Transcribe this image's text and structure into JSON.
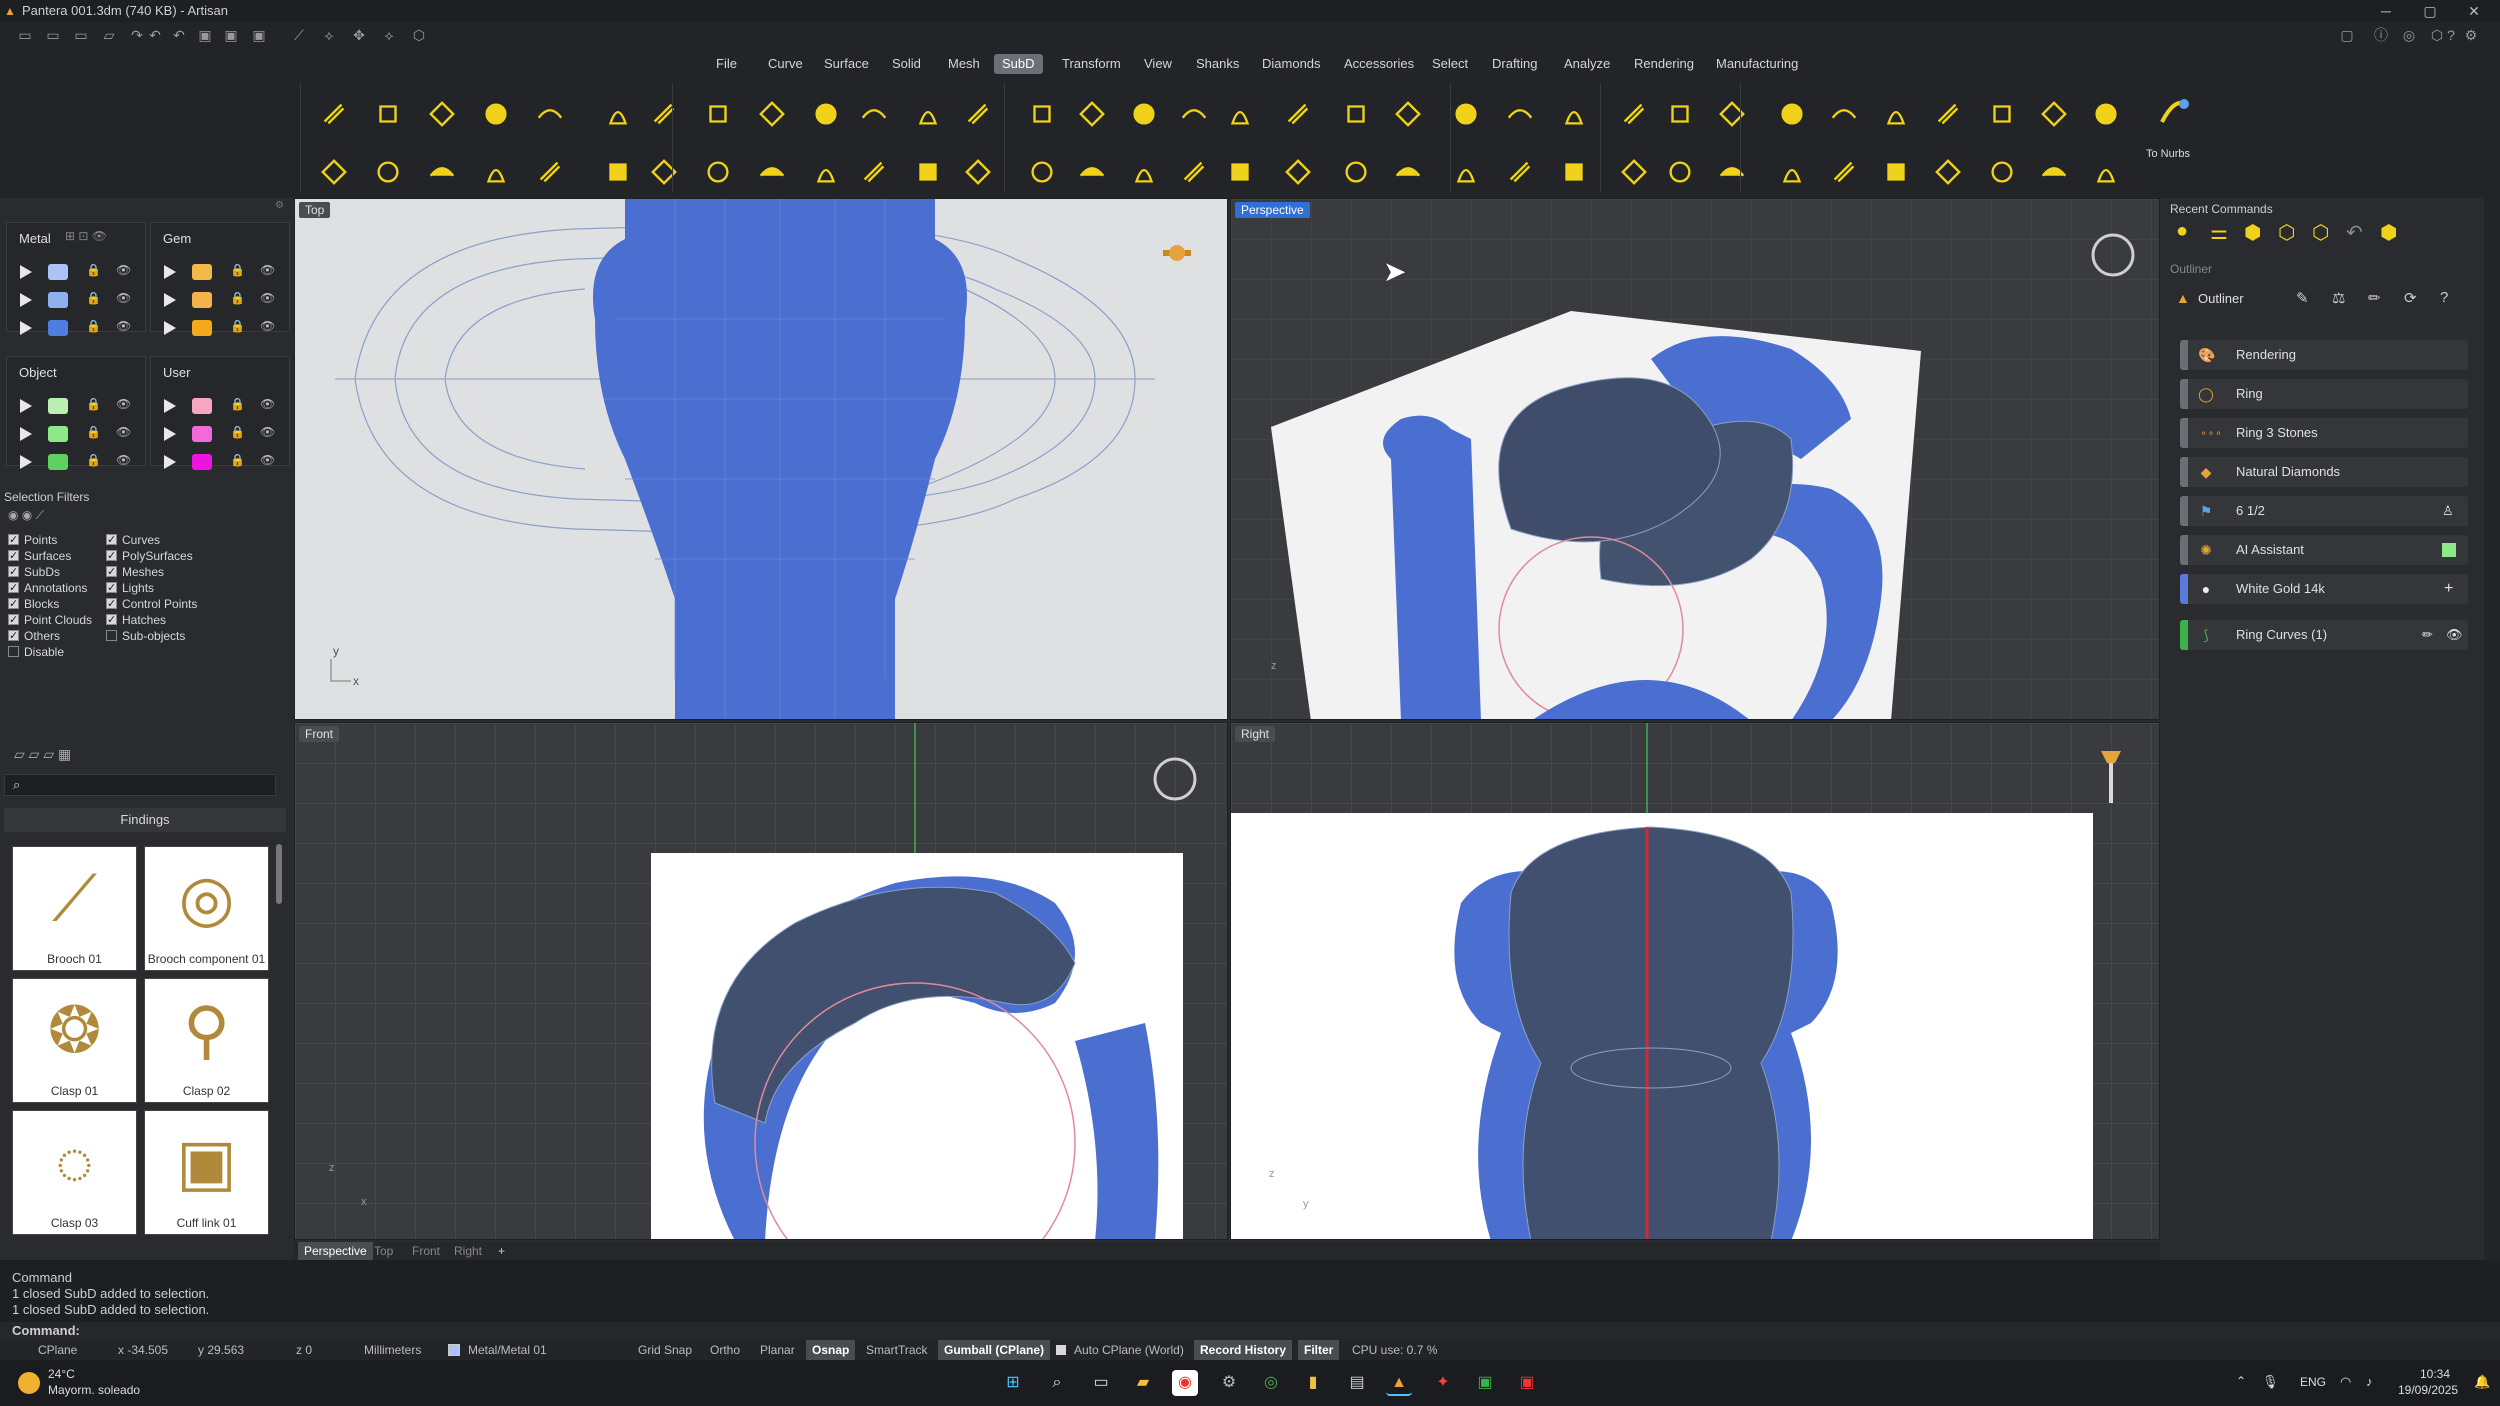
{
  "window": {
    "title": "Pantera 001.3dm (740 KB) - Artisan",
    "controls": [
      "─",
      "▢",
      "✕"
    ]
  },
  "menu": {
    "items": [
      "File",
      "Curve",
      "Surface",
      "Solid",
      "Mesh",
      "SubD",
      "Transform",
      "View",
      "Shanks",
      "Diamonds",
      "Accessories",
      "Select",
      "Drafting",
      "Analyze",
      "Rendering",
      "Manufacturing"
    ],
    "active": "SubD"
  },
  "ribbon": {
    "to_nurbs_label": "To Nurbs"
  },
  "layers": {
    "groups": [
      {
        "name": "Metal",
        "colors": [
          "#a9c4f5",
          "#8fb0ee",
          "#4f7de0"
        ]
      },
      {
        "name": "Gem",
        "colors": [
          "#f5b94a",
          "#f3b24a",
          "#f2a91a"
        ]
      },
      {
        "name": "Object",
        "colors": [
          "#b9f2b0",
          "#8ee88a",
          "#5fcf5f"
        ]
      },
      {
        "name": "User",
        "colors": [
          "#f5a7c2",
          "#f06ad8",
          "#ee14e0"
        ]
      }
    ]
  },
  "selection_filters": {
    "title": "Selection Filters",
    "left": [
      {
        "label": "Points",
        "on": true
      },
      {
        "label": "Surfaces",
        "on": true
      },
      {
        "label": "SubDs",
        "on": true
      },
      {
        "label": "Annotations",
        "on": true
      },
      {
        "label": "Blocks",
        "on": true
      },
      {
        "label": "Point Clouds",
        "on": true
      },
      {
        "label": "Others",
        "on": true
      },
      {
        "label": "Disable",
        "on": false
      }
    ],
    "right": [
      {
        "label": "Curves",
        "on": true
      },
      {
        "label": "PolySurfaces",
        "on": true
      },
      {
        "label": "Meshes",
        "on": true
      },
      {
        "label": "Lights",
        "on": true
      },
      {
        "label": "Control Points",
        "on": true
      },
      {
        "label": "Hatches",
        "on": true
      },
      {
        "label": "Sub-objects",
        "on": false
      }
    ]
  },
  "library": {
    "category": "Findings",
    "items": [
      "Brooch 01",
      "Brooch component 01",
      "Clasp 01",
      "Clasp 02",
      "Clasp 03",
      "Cuff link 01"
    ]
  },
  "viewports": {
    "top": "Top",
    "perspective": "Perspective",
    "front": "Front",
    "right": "Right",
    "tabs": [
      "Perspective",
      "Top",
      "Front",
      "Right"
    ],
    "add_tab": "+"
  },
  "recent_commands": {
    "title": "Recent Commands"
  },
  "outliner": {
    "panel_title": "Outliner",
    "header": "Outliner",
    "rows": [
      {
        "label": "Rendering",
        "icon": "palette-icon"
      },
      {
        "label": "Ring",
        "icon": "ring-icon"
      },
      {
        "label": "Ring 3 Stones",
        "icon": "three-stones-icon"
      },
      {
        "label": "Natural Diamonds",
        "icon": "diamond-icon"
      },
      {
        "label": "6 1/2",
        "icon": "flag-icon"
      },
      {
        "label": "AI Assistant",
        "icon": "ai-icon"
      },
      {
        "label": "White Gold 14k",
        "icon": "material-icon"
      }
    ],
    "curves_row": "Ring Curves (1)"
  },
  "command": {
    "header": "Command",
    "history": [
      "1 closed SubD added to selection.",
      "1 closed SubD added to selection."
    ],
    "prompt": "Command:"
  },
  "status": {
    "cplane": "CPlane",
    "x": "x -34.505",
    "y": "y 29.563",
    "z": "z 0",
    "units": "Millimeters",
    "layer": "Metal/Metal 01",
    "grid_snap": "Grid Snap",
    "ortho": "Ortho",
    "planar": "Planar",
    "osnap": "Osnap",
    "smarttrack": "SmartTrack",
    "gumball": "Gumball (CPlane)",
    "auto_cplane": "Auto CPlane (World)",
    "record_history": "Record History",
    "filter": "Filter",
    "cpu": "CPU use: 0.7 %"
  },
  "taskbar": {
    "temp": "24°C",
    "weather": "Mayorm. soleado",
    "lang": "ENG",
    "time": "10:34",
    "date": "19/09/2025"
  },
  "colors": {
    "accent": "#2f6fd6",
    "ring_blue": "#4a6fd0",
    "icon_yellow": "#f0d21a"
  }
}
